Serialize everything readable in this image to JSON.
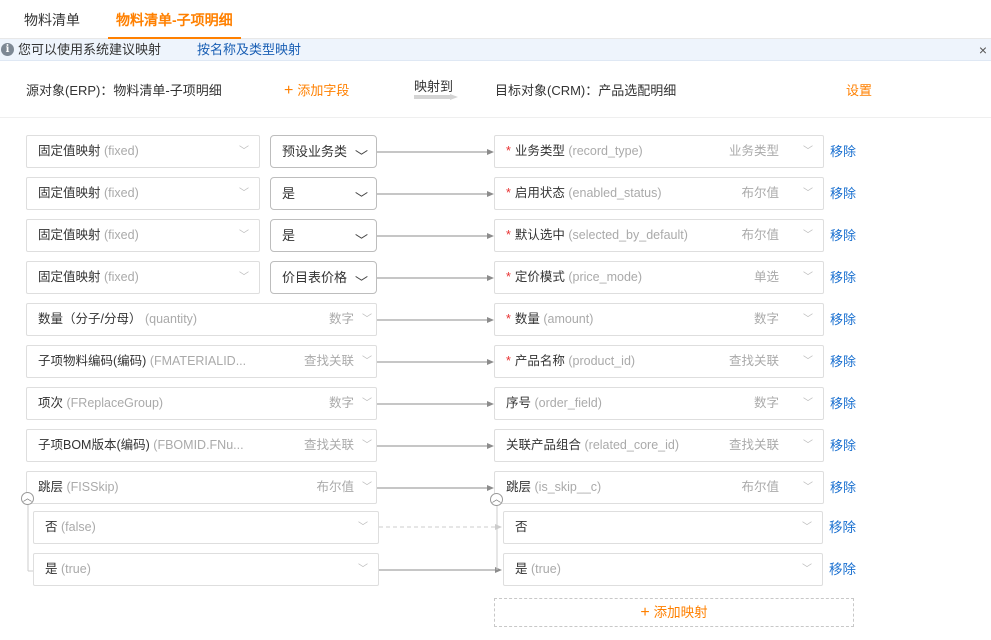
{
  "tabs": [
    {
      "label": "物料清单",
      "active": false
    },
    {
      "label": "物料清单-子项明细",
      "active": true
    }
  ],
  "notice": {
    "icon": "info-icon",
    "message": "您可以使用系统建议映射",
    "link": "按名称及类型映射",
    "close": "×"
  },
  "header": {
    "source": "源对象(ERP)：物料清单-子项明细",
    "add_field": "添加字段",
    "map_label": "映射到",
    "target": "目标对象(CRM)：产品选配明细",
    "settings": "设置"
  },
  "rows": [
    {
      "src": "固定值映射",
      "src_en": "(fixed)",
      "src_type": "",
      "value": "预设业务类",
      "tgt": "业务类型",
      "tgt_en": "(record_type)",
      "tgt_type": "业务类型",
      "required": "*",
      "remove": "移除"
    },
    {
      "src": "固定值映射",
      "src_en": "(fixed)",
      "src_type": "",
      "value": "是",
      "tgt": "启用状态",
      "tgt_en": "(enabled_status)",
      "tgt_type": "布尔值",
      "required": "*",
      "remove": "移除"
    },
    {
      "src": "固定值映射",
      "src_en": "(fixed)",
      "src_type": "",
      "value": "是",
      "tgt": "默认选中",
      "tgt_en": "(selected_by_default)",
      "tgt_type": "布尔值",
      "required": "*",
      "remove": "移除"
    },
    {
      "src": "固定值映射",
      "src_en": "(fixed)",
      "src_type": "",
      "value": "价目表价格",
      "tgt": "定价模式",
      "tgt_en": "(price_mode)",
      "tgt_type": "单选",
      "required": "*",
      "remove": "移除"
    },
    {
      "src": "数量（分子/分母）",
      "src_en": "(quantity)",
      "src_type": "数字",
      "value": "",
      "tgt": "数量",
      "tgt_en": "(amount)",
      "tgt_type": "数字",
      "required": "*",
      "remove": "移除"
    },
    {
      "src": "子项物料编码(编码)",
      "src_en": "(FMATERIALID...",
      "src_type": "查找关联",
      "value": "",
      "tgt": "产品名称",
      "tgt_en": "(product_id)",
      "tgt_type": "查找关联",
      "required": "*",
      "remove": "移除"
    },
    {
      "src": "项次",
      "src_en": "(FReplaceGroup)",
      "src_type": "数字",
      "value": "",
      "tgt": "序号",
      "tgt_en": "(order_field)",
      "tgt_type": "数字",
      "required": "",
      "remove": "移除"
    },
    {
      "src": "子项BOM版本(编码)",
      "src_en": "(FBOMID.FNu...",
      "src_type": "查找关联",
      "value": "",
      "tgt": "关联产品组合",
      "tgt_en": "(related_core_id)",
      "tgt_type": "查找关联",
      "required": "",
      "remove": "移除"
    },
    {
      "src": "跳层",
      "src_en": "(FISSkip)",
      "src_type": "布尔值",
      "value": "",
      "tgt": "跳层",
      "tgt_en": "(is_skip__c)",
      "tgt_type": "布尔值",
      "required": "",
      "remove": "移除"
    }
  ],
  "sub_rows": [
    {
      "src": "否",
      "src_en": "(false)",
      "tgt": "否",
      "tgt_en": "",
      "remove": "移除",
      "dashed": true
    },
    {
      "src": "是",
      "src_en": "(true)",
      "tgt": "是",
      "tgt_en": "(true)",
      "remove": "移除",
      "dashed": false
    }
  ],
  "add_mapping": "添加映射",
  "colors": {
    "accent": "#ff8000",
    "link": "#1a70d0",
    "required": "#e83030"
  }
}
